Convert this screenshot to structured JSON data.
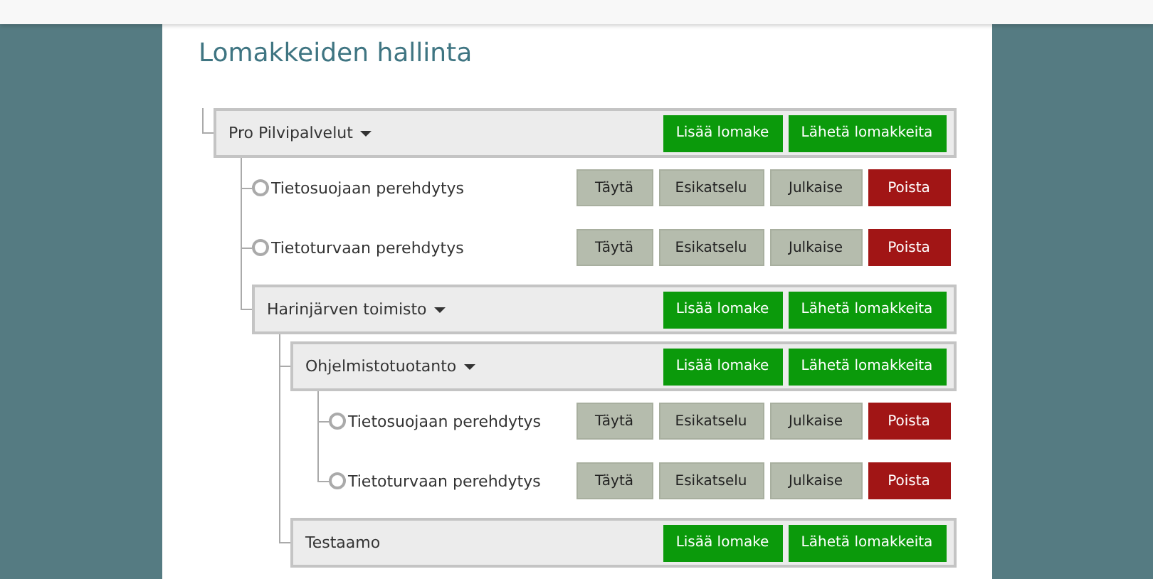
{
  "page": {
    "title": "Lomakkeiden hallinta"
  },
  "tree": [
    {
      "kind": "group",
      "label": "Pro Pilvipalvelut",
      "dropdown": true,
      "actions": [
        {
          "label": "Lisää lomake",
          "kind": "primary"
        },
        {
          "label": "Lähetä lomakkeita",
          "kind": "primary"
        }
      ],
      "children": [
        {
          "kind": "form",
          "label": "Tietosuojaan perehdytys",
          "actions": [
            {
              "label": "Täytä",
              "kind": "neutral"
            },
            {
              "label": "Esikatselu",
              "kind": "neutral"
            },
            {
              "label": "Julkaise",
              "kind": "neutral"
            },
            {
              "label": "Poista",
              "kind": "danger"
            }
          ]
        },
        {
          "kind": "form",
          "label": "Tietoturvaan perehdytys",
          "actions": [
            {
              "label": "Täytä",
              "kind": "neutral"
            },
            {
              "label": "Esikatselu",
              "kind": "neutral"
            },
            {
              "label": "Julkaise",
              "kind": "neutral"
            },
            {
              "label": "Poista",
              "kind": "danger"
            }
          ]
        },
        {
          "kind": "group",
          "label": "Harinjärven toimisto",
          "dropdown": true,
          "actions": [
            {
              "label": "Lisää lomake",
              "kind": "primary"
            },
            {
              "label": "Lähetä lomakkeita",
              "kind": "primary"
            }
          ],
          "children": [
            {
              "kind": "group",
              "label": "Ohjelmistotuotanto",
              "dropdown": true,
              "actions": [
                {
                  "label": "Lisää lomake",
                  "kind": "primary"
                },
                {
                  "label": "Lähetä lomakkeita",
                  "kind": "primary"
                }
              ],
              "children": [
                {
                  "kind": "form",
                  "label": "Tietosuojaan perehdytys",
                  "actions": [
                    {
                      "label": "Täytä",
                      "kind": "neutral"
                    },
                    {
                      "label": "Esikatselu",
                      "kind": "neutral"
                    },
                    {
                      "label": "Julkaise",
                      "kind": "neutral"
                    },
                    {
                      "label": "Poista",
                      "kind": "danger"
                    }
                  ]
                },
                {
                  "kind": "form",
                  "label": "Tietoturvaan perehdytys",
                  "actions": [
                    {
                      "label": "Täytä",
                      "kind": "neutral"
                    },
                    {
                      "label": "Esikatselu",
                      "kind": "neutral"
                    },
                    {
                      "label": "Julkaise",
                      "kind": "neutral"
                    },
                    {
                      "label": "Poista",
                      "kind": "danger"
                    }
                  ]
                }
              ]
            },
            {
              "kind": "group",
              "label": "Testaamo",
              "dropdown": false,
              "actions": [
                {
                  "label": "Lisää lomake",
                  "kind": "primary"
                },
                {
                  "label": "Lähetä lomakkeita",
                  "kind": "primary"
                }
              ]
            }
          ]
        }
      ]
    }
  ]
}
